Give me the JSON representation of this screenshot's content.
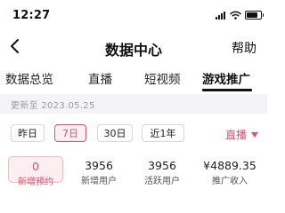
{
  "status_bar": {
    "time": "12:27"
  },
  "nav": {
    "title": "数据中心",
    "help_label": "帮助"
  },
  "tabs": [
    {
      "label": "数据总览",
      "active": false
    },
    {
      "label": "直播",
      "active": false
    },
    {
      "label": "短视频",
      "active": false
    },
    {
      "label": "游戏推广",
      "active": true
    }
  ],
  "updated": {
    "text": "更新至 2023.05.25"
  },
  "filters": {
    "ranges": [
      {
        "label": "昨日",
        "active": false
      },
      {
        "label": "7日",
        "active": true
      },
      {
        "label": "30日",
        "active": false
      },
      {
        "label": "近1年",
        "active": false
      }
    ],
    "channel": "直播"
  },
  "metrics": [
    {
      "value": "0",
      "label": "新增预约",
      "active": true
    },
    {
      "value": "3956",
      "label": "新增用户",
      "active": false
    },
    {
      "value": "3956",
      "label": "活跃用户",
      "active": false
    },
    {
      "value": "¥4889.35",
      "label": "推广收入",
      "active": false
    }
  ],
  "colors": {
    "accent": "#e0506e",
    "accent_bg": "#fdeff2",
    "updated_bar_bg": "#f4f4f6"
  },
  "icons": {
    "back": "chevron-left-icon",
    "signal": "signal-icon",
    "wifi": "wifi-icon",
    "battery": "battery-icon",
    "dropdown": "caret-down-icon"
  }
}
